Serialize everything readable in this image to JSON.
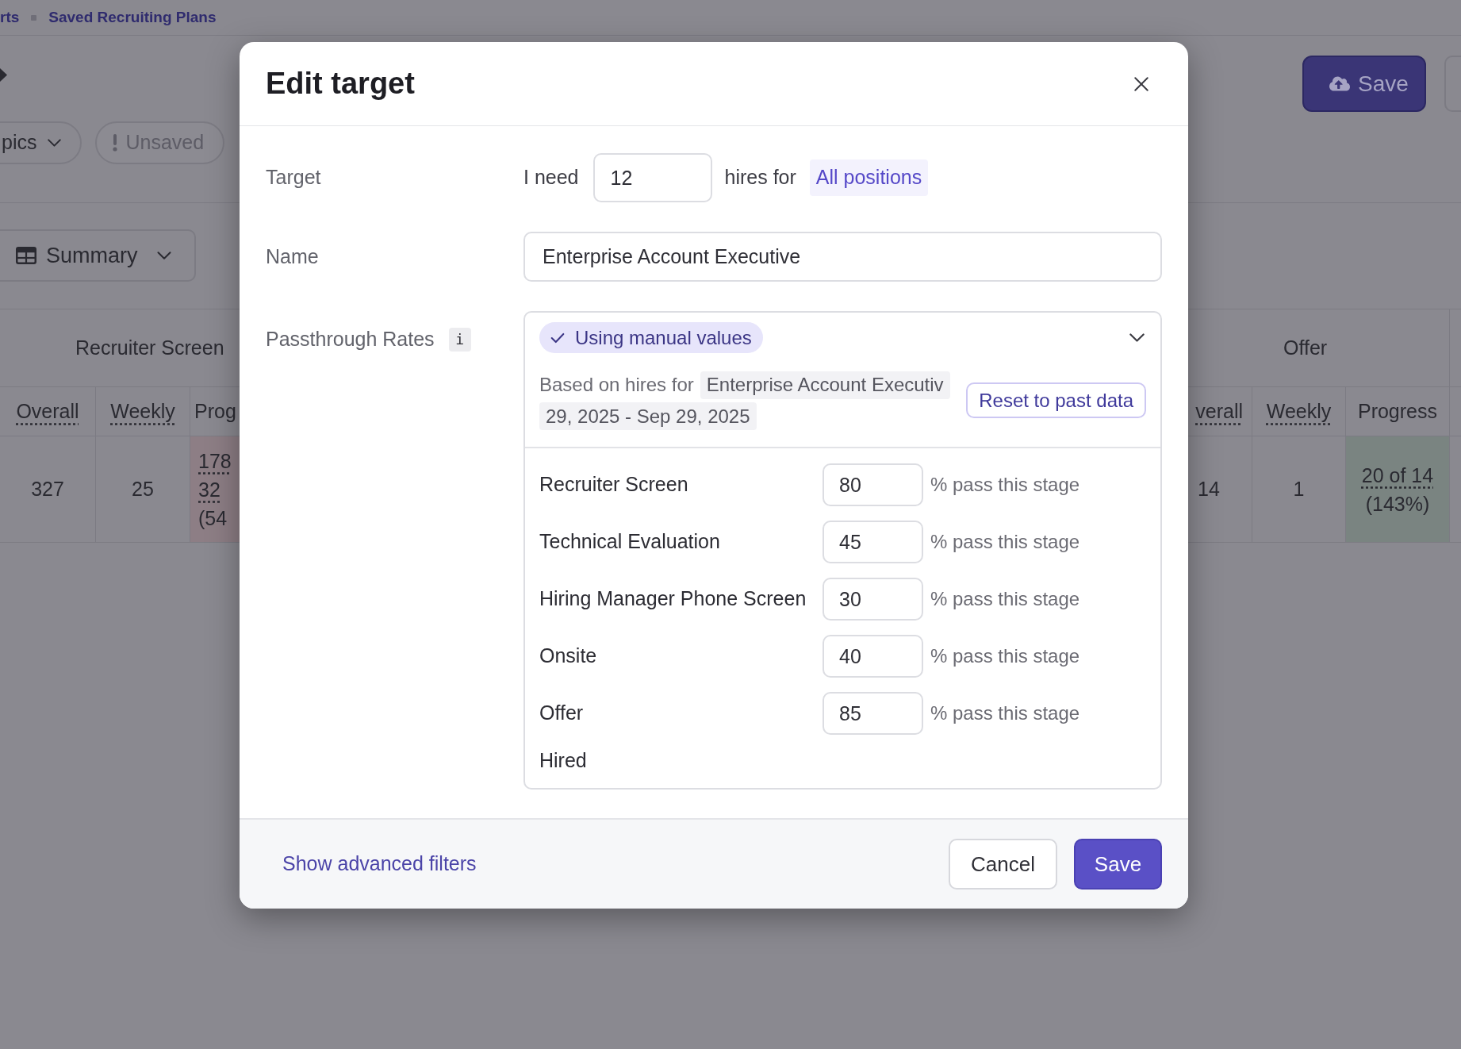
{
  "breadcrumb": {
    "items": [
      {
        "label": "rts"
      },
      {
        "label": "Saved Recruiting Plans"
      }
    ]
  },
  "header": {
    "save_button": "Save"
  },
  "filters": [
    {
      "kind": "dropdown",
      "label": "pics"
    },
    {
      "kind": "status",
      "label": "Unsaved"
    }
  ],
  "view_selector": {
    "label": "Summary"
  },
  "table": {
    "groups": [
      {
        "title": "Recruiter Screen",
        "columns": [
          {
            "label": "Overall",
            "underlined": true
          },
          {
            "label": "Weekly",
            "underlined": true
          },
          {
            "label": "Prog",
            "underlined": false
          }
        ],
        "cells": [
          {
            "kind": "number",
            "text": "327"
          },
          {
            "kind": "number",
            "text": "25"
          },
          {
            "kind": "progress",
            "color": "#8d7e85",
            "lines": [
              {
                "text": "178",
                "underlined": true
              },
              {
                "text": "32",
                "underlined": true
              },
              {
                "text": "(54",
                "underlined": false
              }
            ]
          }
        ]
      },
      {
        "title": "Offer",
        "columns": [
          {
            "label": "verall",
            "underlined": true
          },
          {
            "label": "Weekly",
            "underlined": true
          },
          {
            "label": "Progress",
            "underlined": false
          }
        ],
        "cells": [
          {
            "kind": "number",
            "text": "14"
          },
          {
            "kind": "number",
            "text": "1"
          },
          {
            "kind": "progress",
            "color": "#7a8481",
            "lines": [
              {
                "text": "20 of 14",
                "underlined": true
              },
              {
                "text": "(143%)",
                "underlined": false
              }
            ]
          }
        ]
      }
    ]
  },
  "dialog": {
    "title": "Edit target",
    "target": {
      "label": "Target",
      "prefix": "I need",
      "value": "12",
      "suffix": "hires for",
      "scope": "All positions"
    },
    "name": {
      "label": "Name",
      "value": "Enterprise Account Executive"
    },
    "passthrough": {
      "label": "Passthrough Rates",
      "info": "i",
      "mode": {
        "label": "Using manual values",
        "checked": true
      },
      "basis": {
        "text": "Based on hires for",
        "chips": [
          "Enterprise Account Executiv",
          "29, 2025 - Sep 29, 2025"
        ]
      },
      "reset_button": "Reset to past data",
      "stages": [
        {
          "kind": "rate",
          "name": "Recruiter Screen",
          "value": "80",
          "suffix": "% pass this stage"
        },
        {
          "kind": "rate",
          "name": "Technical Evaluation",
          "value": "45",
          "suffix": "% pass this stage"
        },
        {
          "kind": "rate",
          "name": "Hiring Manager Phone Screen",
          "value": "30",
          "suffix": "% pass this stage"
        },
        {
          "kind": "rate",
          "name": "Onsite",
          "value": "40",
          "suffix": "% pass this stage"
        },
        {
          "kind": "rate",
          "name": "Offer",
          "value": "85",
          "suffix": "% pass this stage"
        },
        {
          "kind": "final",
          "name": "Hired"
        }
      ]
    },
    "footer": {
      "link": "Show advanced filters",
      "cancel_button": "Cancel",
      "save_button": "Save"
    }
  }
}
